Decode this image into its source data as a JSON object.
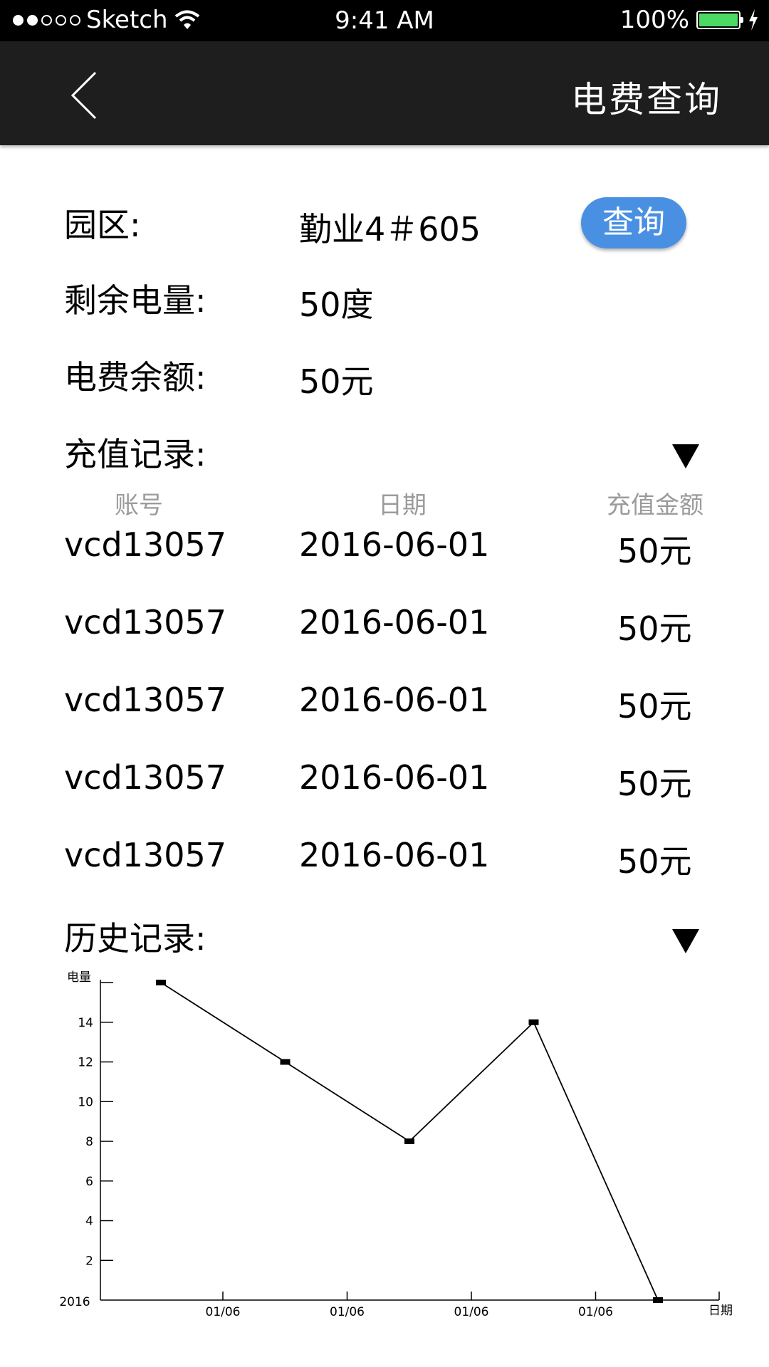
{
  "status_bar": {
    "carrier": "Sketch",
    "time": "9:41 AM",
    "battery": "100%",
    "signal_bars": 2,
    "signal_total": 5
  },
  "nav": {
    "title": "电费查询",
    "back_icon": "chevron-left-icon"
  },
  "info": {
    "park_label": "园区:",
    "park_value": "勤业4＃605",
    "query_button": "查询",
    "remaining_power_label": "剩余电量:",
    "remaining_power_value": "50度",
    "balance_label": "电费余额:",
    "balance_value": "50元"
  },
  "recharge": {
    "title": "充值记录:",
    "toggle_icon": "triangle-down-icon",
    "columns": [
      "账号",
      "日期",
      "充值金额"
    ],
    "rows": [
      {
        "account": "vcd13057",
        "date": "2016-06-01",
        "amount": "50元"
      },
      {
        "account": "vcd13057",
        "date": "2016-06-01",
        "amount": "50元"
      },
      {
        "account": "vcd13057",
        "date": "2016-06-01",
        "amount": "50元"
      },
      {
        "account": "vcd13057",
        "date": "2016-06-01",
        "amount": "50元"
      },
      {
        "account": "vcd13057",
        "date": "2016-06-01",
        "amount": "50元"
      }
    ]
  },
  "history": {
    "title": "历史记录:",
    "toggle_icon": "triangle-down-icon"
  },
  "chart_data": {
    "type": "line",
    "ylabel": "电量",
    "xlabel": "日期",
    "origin_label": "2016",
    "y_ticks": [
      2,
      4,
      6,
      8,
      10,
      12,
      14
    ],
    "x_ticks": [
      "01/06",
      "01/06",
      "01/06",
      "01/06"
    ],
    "ylim": [
      0,
      16
    ],
    "values": [
      16,
      12,
      8,
      14,
      0
    ],
    "grid": false,
    "line_color": "#000000"
  },
  "colors": {
    "nav_bg": "#1e1e1e",
    "accent": "#4a90e2",
    "battery": "#4cd964",
    "header_text": "#9b9b9b"
  }
}
